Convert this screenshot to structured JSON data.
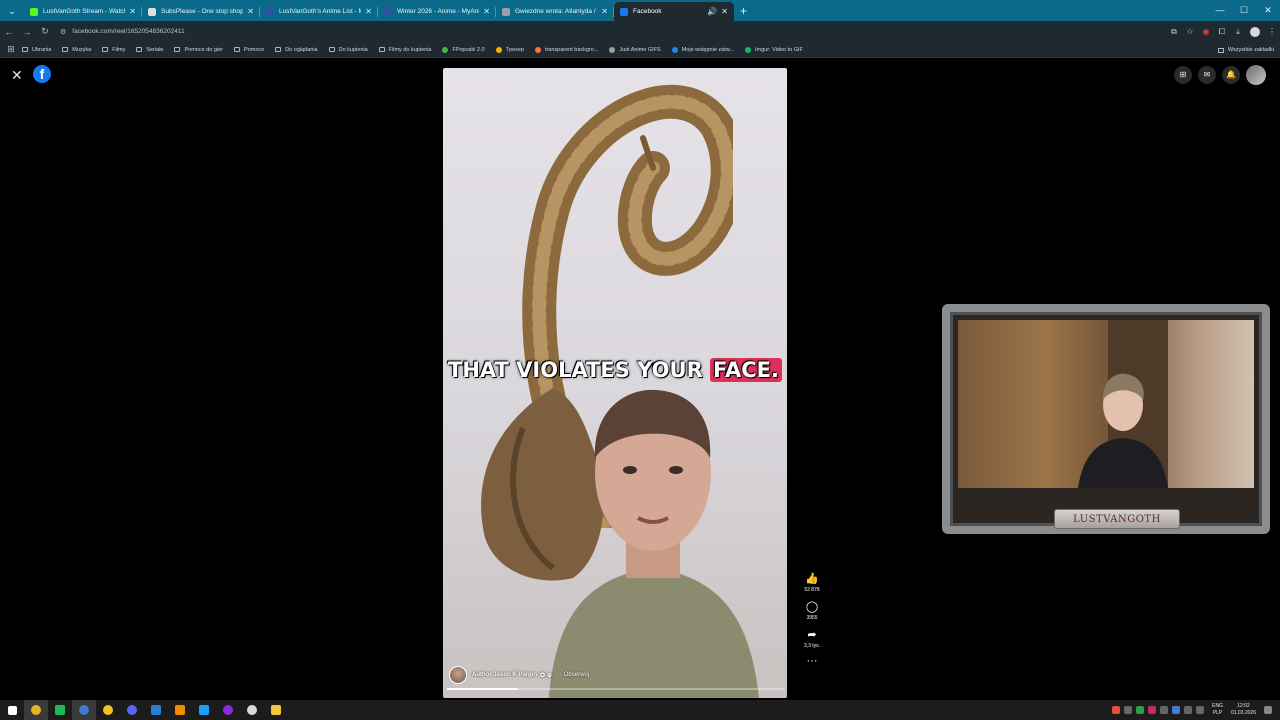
{
  "browser": {
    "tabs": [
      {
        "title": "LustVanGoth Stream - Watch L",
        "favicon_color": "#53fc18"
      },
      {
        "title": "SubsPlease - One stop shop fo",
        "favicon_color": "#e0e0e0"
      },
      {
        "title": "LustVanGoth's Anime List - My",
        "favicon_color": "#2e51a2"
      },
      {
        "title": "Winter 2026 - Anime - MyAnim",
        "favicon_color": "#2e51a2"
      },
      {
        "title": "Gwiezdne wrota: Atlantyda / St",
        "favicon_color": "#9aa0a6"
      },
      {
        "title": "Facebook",
        "favicon_color": "#1877f2",
        "active": true
      }
    ],
    "url": "facebook.com/reel/1652054836202411",
    "bookmarks": [
      {
        "label": "Ubrania",
        "kind": "folder"
      },
      {
        "label": "Muzyka",
        "kind": "folder"
      },
      {
        "label": "Filmy",
        "kind": "folder"
      },
      {
        "label": "Seriale",
        "kind": "folder"
      },
      {
        "label": "Pomoce do gier",
        "kind": "folder"
      },
      {
        "label": "Pomoce",
        "kind": "folder"
      },
      {
        "label": "Do oglądania",
        "kind": "folder"
      },
      {
        "label": "Do kupienia",
        "kind": "folder"
      },
      {
        "label": "Filmy do kupienia",
        "kind": "folder"
      },
      {
        "label": "FPopuski 2.0",
        "kind": "site",
        "color": "#4caf50"
      },
      {
        "label": "Tpexep",
        "kind": "site",
        "color": "#ffb300"
      },
      {
        "label": "transparent backgro...",
        "kind": "site",
        "color": "#ff7043"
      },
      {
        "label": "Just Anime GIFS",
        "kind": "site",
        "color": "#9e9e9e"
      },
      {
        "label": "Moje wstępnie zatw...",
        "kind": "site",
        "color": "#1e88e5"
      },
      {
        "label": "Imgur: Video to GIF",
        "kind": "site",
        "color": "#1bb76e"
      }
    ],
    "bookmarks_right": "Wszystkie zakładki"
  },
  "reel": {
    "caption_pre": "THAT VIOLATES YOUR",
    "caption_hl": "FACE.",
    "author_name": "Author Jason K Pargin",
    "follow_label": "Obserwuj",
    "progress": 0.21,
    "likes": "52 878",
    "comments": "3955",
    "shares": "3,3 tys."
  },
  "overlay": {
    "nameplate": "LUSTVANGOTH"
  },
  "taskbar": {
    "lang_top": "ENG",
    "lang_bottom": "PLP",
    "time": "12:02",
    "date": "01.03.2026"
  },
  "colors": {
    "facebook_blue": "#1877f2",
    "caption_highlight": "#e0315a",
    "tab_strip": "#0b6a8a"
  }
}
